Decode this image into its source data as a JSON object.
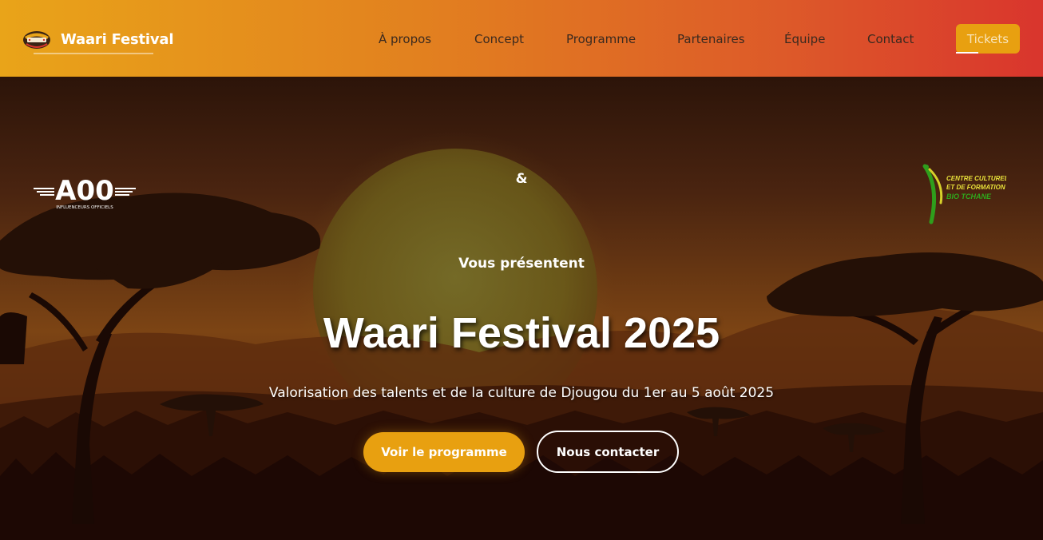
{
  "brand": {
    "name": "Waari Festival",
    "logo_icon": "waari-logo-icon"
  },
  "nav": {
    "items": [
      {
        "label": "À propos"
      },
      {
        "label": "Concept"
      },
      {
        "label": "Programme"
      },
      {
        "label": "Partenaires"
      },
      {
        "label": "Équipe"
      },
      {
        "label": "Contact"
      }
    ],
    "tickets_label": "Tickets"
  },
  "hero": {
    "partner_left": {
      "logo_text": "A00",
      "caption": "INFLUENCEURS OFFICIELS"
    },
    "ampersand": "&",
    "partner_right": {
      "line1": "CENTRE CULTUREL",
      "line2": "ET DE FORMATION",
      "line3": "BIO TCHANE"
    },
    "presenting": "Vous présentent",
    "title": "Waari Festival 2025",
    "subtitle": "Valorisation des talents et de la culture de Djougou du 1er au 5 août 2025",
    "primary_button": "Voir le programme",
    "secondary_button": "Nous contacter"
  },
  "colors": {
    "nav_gradient_start": "#e9a419",
    "nav_gradient_end": "#d9352d",
    "accent": "#e8a010",
    "nav_text": "#3b2a1f"
  }
}
